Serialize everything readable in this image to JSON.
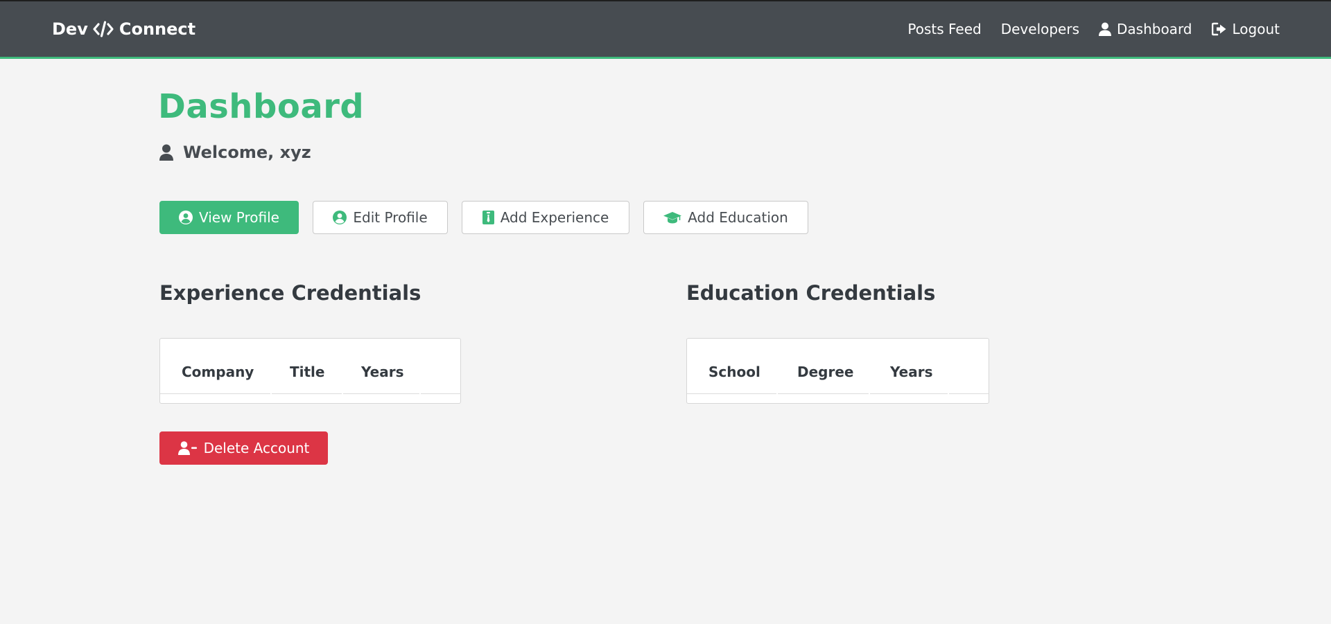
{
  "nav": {
    "brand_left": "Dev",
    "brand_icon": "code-icon",
    "brand_right": "Connect",
    "links": [
      {
        "label": "Posts Feed"
      },
      {
        "label": "Developers"
      },
      {
        "label": "Dashboard",
        "icon": "user-icon"
      },
      {
        "label": "Logout",
        "icon": "sign-out-icon"
      }
    ]
  },
  "main": {
    "title": "Dashboard",
    "welcome": "Welcome, xyz",
    "welcome_icon": "user-icon",
    "actions": {
      "view_profile": "View Profile",
      "edit_profile": "Edit Profile",
      "add_experience": "Add Experience",
      "add_education": "Add Education"
    },
    "experience": {
      "title": "Experience Credentials",
      "columns": [
        "Company",
        "Title",
        "Years"
      ]
    },
    "education": {
      "title": "Education Credentials",
      "columns": [
        "School",
        "Degree",
        "Years"
      ]
    },
    "delete_account": "Delete Account"
  },
  "colors": {
    "primary": "#3eba7c",
    "navbar": "#474c51",
    "danger": "#dc3545",
    "background": "#f4f4f4"
  }
}
